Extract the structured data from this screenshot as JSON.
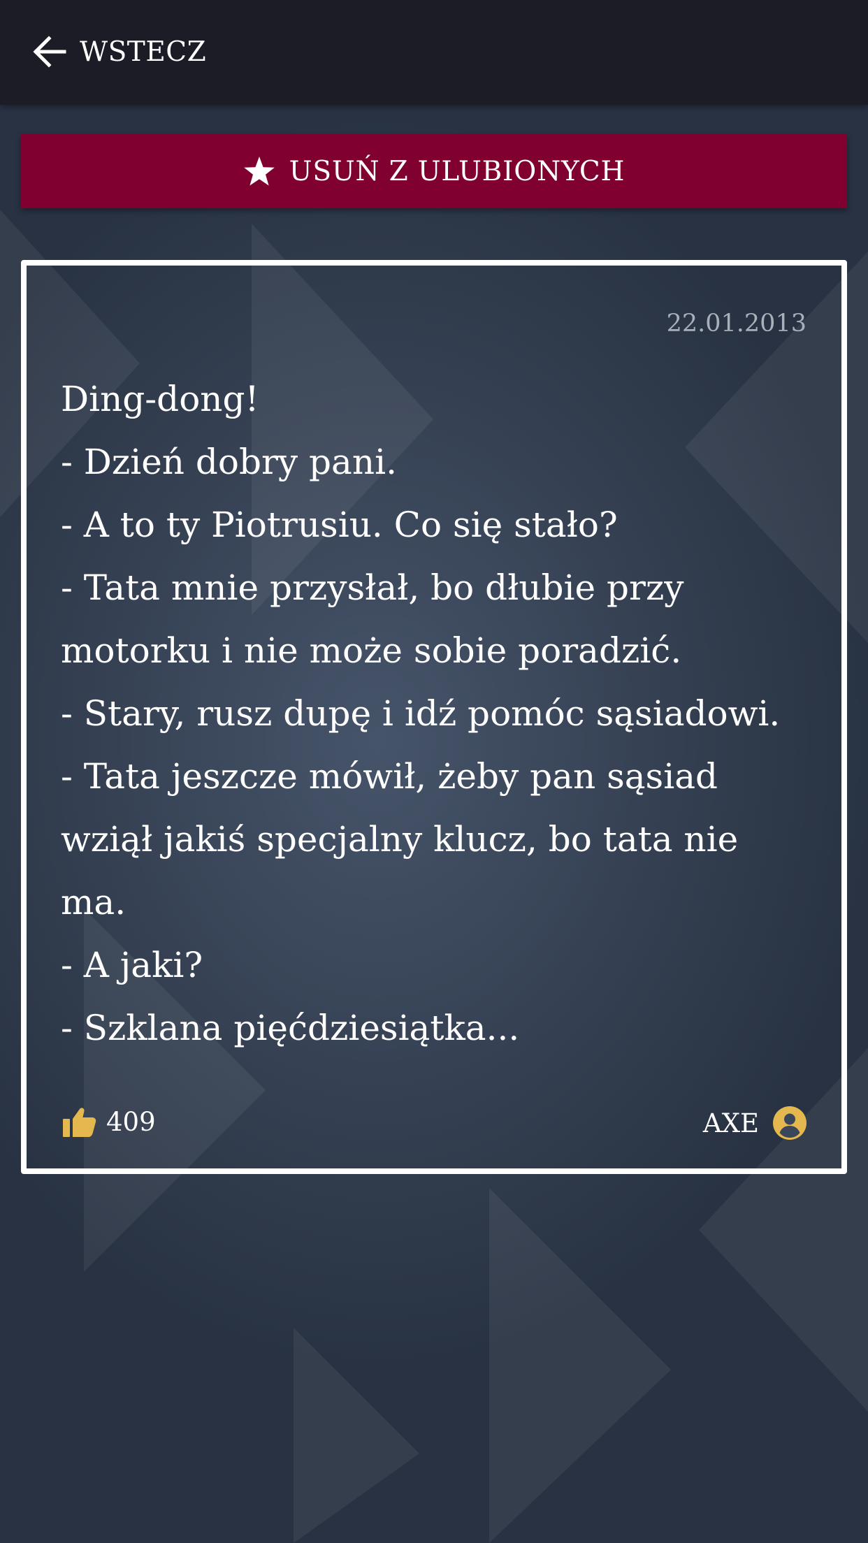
{
  "header": {
    "back_label": "WSTECZ",
    "back_icon": "arrow-left-icon"
  },
  "favorite_button": {
    "label": "USUŃ Z ULUBIONYCH",
    "icon": "star-icon",
    "color": "#800030"
  },
  "joke": {
    "date": "22.01.2013",
    "lines": [
      "Ding-dong!",
      "- Dzień dobry pani.",
      "- A to ty Piotrusiu. Co się stało?",
      "- Tata mnie przysłał, bo dłubie przy",
      "motorku i nie może sobie poradzić.",
      "- Stary, rusz dupę i idź pomóc sąsiadowi.",
      "- Tata jeszcze mówił, żeby pan sąsiad",
      "wziął jakiś specjalny klucz, bo tata nie",
      "ma.",
      "- A jaki?",
      "- Szklana pięćdziesiątka..."
    ],
    "likes": "409",
    "likes_icon": "thumbs-up-icon",
    "author": "AXE",
    "author_icon": "user-circle-icon"
  },
  "colors": {
    "topbar": "#1b1c26",
    "accent": "#e5b84f",
    "card_border": "#ffffff",
    "date_text": "#a9b0ba"
  }
}
